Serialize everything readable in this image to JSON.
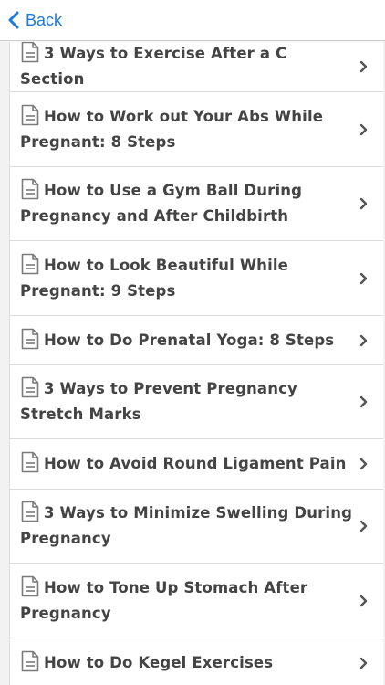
{
  "nav": {
    "back_label": "Back",
    "accent_color": "#1a7ae0"
  },
  "articles": [
    {
      "title": "3 Ways to Exercise After a C Section"
    },
    {
      "title": "How to Work out Your Abs While Pregnant: 8 Steps"
    },
    {
      "title": "How to Use a Gym Ball During Pregnancy and After Childbirth"
    },
    {
      "title": "How to Look Beautiful While Pregnant: 9 Steps"
    },
    {
      "title": "How to Do Prenatal Yoga: 8 Steps"
    },
    {
      "title": "3 Ways to Prevent Pregnancy Stretch Marks"
    },
    {
      "title": "How to Avoid Round Ligament Pain"
    },
    {
      "title": "3 Ways to Minimize Swelling During Pregnancy"
    },
    {
      "title": "How to Tone Up Stomach After Pregnancy"
    },
    {
      "title": "How to Do Kegel Exercises"
    }
  ],
  "icons": {
    "row_icon": "document-icon",
    "row_chevron": "chevron-right-icon",
    "back_icon": "chevron-left-icon"
  }
}
